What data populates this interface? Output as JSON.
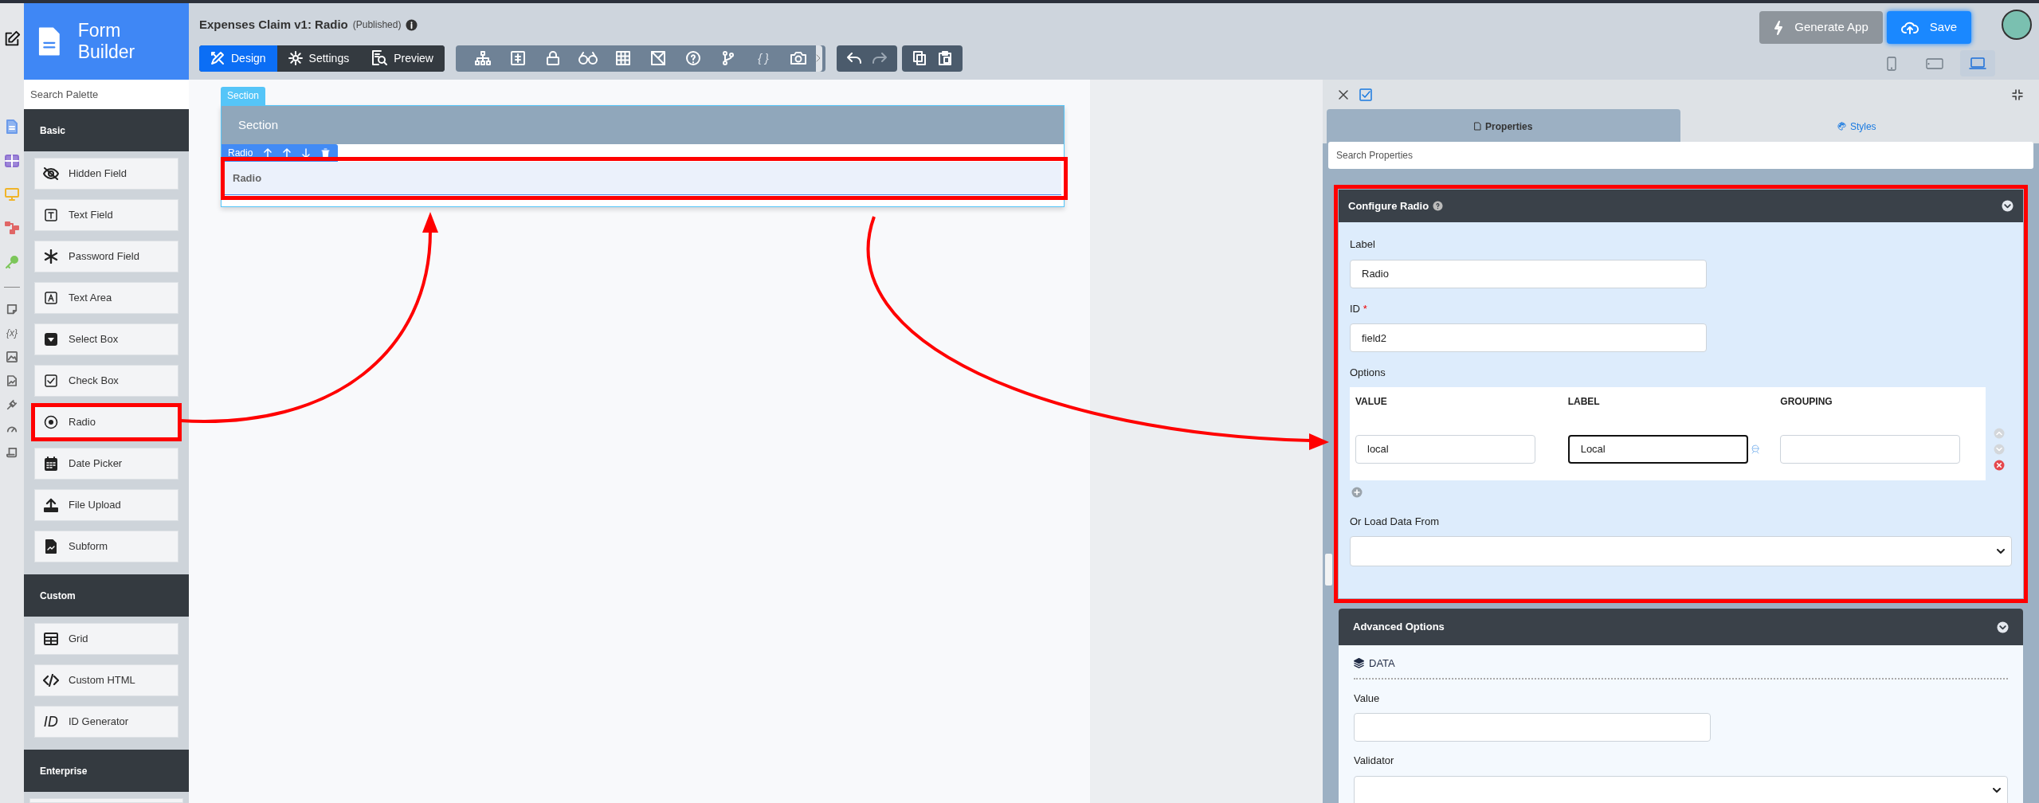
{
  "sidebar_rail": {
    "glyph": "{x}"
  },
  "palette": {
    "title": "Form Builder",
    "search": {
      "placeholder": "Search Palette"
    },
    "groups": [
      {
        "title": "Basic",
        "items": [
          {
            "label": "Hidden Field",
            "highlighted": false
          },
          {
            "label": "Text Field",
            "highlighted": false
          },
          {
            "label": "Password Field",
            "highlighted": false
          },
          {
            "label": "Text Area",
            "highlighted": false
          },
          {
            "label": "Select Box",
            "highlighted": false
          },
          {
            "label": "Check Box",
            "highlighted": false
          },
          {
            "label": "Radio",
            "highlighted": true
          },
          {
            "label": "Date Picker",
            "highlighted": false
          },
          {
            "label": "File Upload",
            "highlighted": false
          },
          {
            "label": "Subform",
            "highlighted": false
          }
        ]
      },
      {
        "title": "Custom",
        "items": [
          {
            "label": "Grid",
            "highlighted": false
          },
          {
            "label": "Custom HTML",
            "highlighted": false
          },
          {
            "label": "ID Generator",
            "highlighted": false,
            "glyph": "ID"
          }
        ]
      },
      {
        "title": "Enterprise"
      }
    ]
  },
  "header": {
    "title": "Expenses Claim v1: Radio",
    "status": "(Published)",
    "modes": [
      {
        "label": "Design",
        "selected": true
      },
      {
        "label": "Settings",
        "selected": false
      },
      {
        "label": "Preview",
        "selected": false
      }
    ],
    "tool_glyph": "{ }",
    "actions": [
      {
        "label": "Generate App",
        "kind": "secondary"
      },
      {
        "label": "Save",
        "kind": "primary"
      }
    ],
    "devices": [
      {
        "selected": false
      },
      {
        "selected": false
      },
      {
        "selected": true
      }
    ]
  },
  "canvas": {
    "section": {
      "tab": "Section",
      "title": "Section",
      "field": {
        "toolbar_label": "Radio",
        "label": "Radio",
        "highlighted": true
      }
    }
  },
  "properties": {
    "tabs": [
      {
        "label": "Properties",
        "selected": true
      },
      {
        "label": "Styles",
        "selected": false
      }
    ],
    "search": {
      "placeholder": "Search Properties"
    },
    "configure": {
      "title": "Configure Radio",
      "highlighted": true,
      "label_field": {
        "label": "Label",
        "value": "Radio"
      },
      "id_field": {
        "label": "ID",
        "required": true,
        "required_mark": "*",
        "value": "field2"
      },
      "options": {
        "label": "Options",
        "columns": [
          "VALUE",
          "LABEL",
          "GROUPING"
        ],
        "rows": [
          {
            "cells": [
              {
                "value": "local",
                "focused": false
              },
              {
                "value": "Local",
                "focused": true
              },
              {
                "focused": false
              }
            ]
          }
        ]
      },
      "load_from": {
        "label": "Or Load Data From"
      }
    },
    "advanced": {
      "title": "Advanced Options",
      "section": "DATA",
      "fields": [
        {
          "label": "Value",
          "kind": "text"
        },
        {
          "label": "Validator",
          "kind": "select"
        }
      ]
    }
  }
}
